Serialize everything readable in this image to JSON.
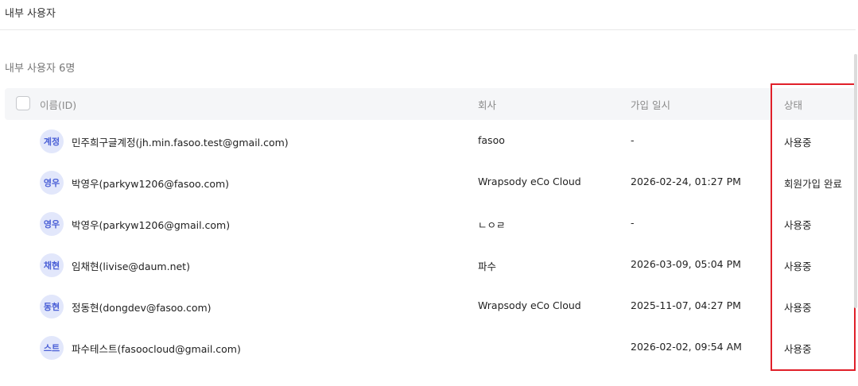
{
  "header": {
    "title": "내부 사용자"
  },
  "summary": {
    "count_label": "내부 사용자 6명"
  },
  "table": {
    "columns": {
      "name": "이름(ID)",
      "company": "회사",
      "joined": "가입 일시",
      "status": "상태"
    },
    "rows": [
      {
        "avatar": "계정",
        "name": "민주희구글계정(jh.min.fasoo.test@gmail.com)",
        "company": "fasoo",
        "joined": "-",
        "status": "사용중"
      },
      {
        "avatar": "영우",
        "name": "박영우(parkyw1206@fasoo.com)",
        "company": "Wrapsody eCo Cloud",
        "joined": "2026-02-24, 01:27 PM",
        "status": "회원가입 완료"
      },
      {
        "avatar": "영우",
        "name": "박영우(parkyw1206@gmail.com)",
        "company": "ㄴㅇㄹ",
        "joined": "-",
        "status": "사용중"
      },
      {
        "avatar": "채현",
        "name": "임채현(livise@daum.net)",
        "company": "파수",
        "joined": "2026-03-09, 05:04 PM",
        "status": "사용중"
      },
      {
        "avatar": "동현",
        "name": "정동현(dongdev@fasoo.com)",
        "company": "Wrapsody eCo Cloud",
        "joined": "2025-11-07, 04:27 PM",
        "status": "사용중"
      },
      {
        "avatar": "스트",
        "name": "파수테스트(fasoocloud@gmail.com)",
        "company": "",
        "joined": "2026-02-02, 09:54 AM",
        "status": "사용중"
      }
    ]
  },
  "colors": {
    "avatar_bg": "#e2e7fb",
    "avatar_text": "#4a5fd6",
    "highlight": "#e0202a"
  }
}
